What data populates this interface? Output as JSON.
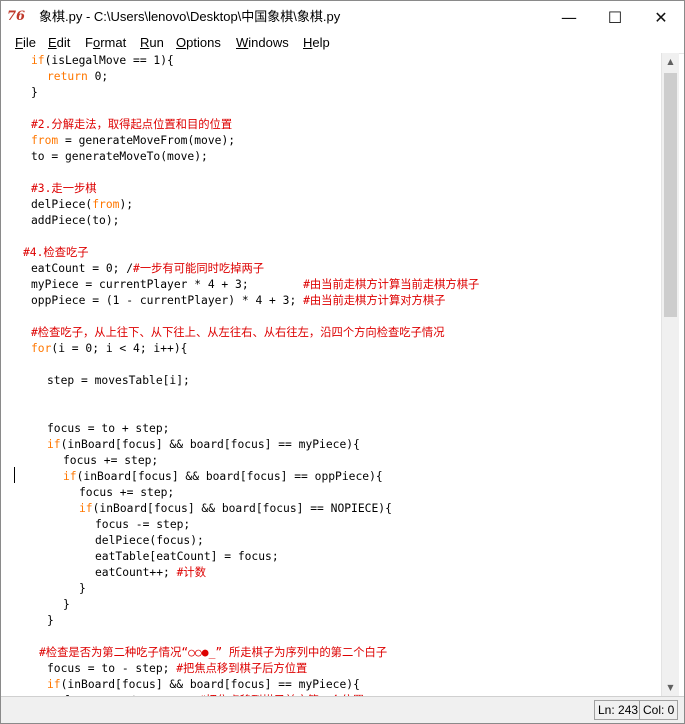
{
  "window": {
    "icon_text": "76",
    "title": "象棋.py - C:\\Users\\lenovo\\Desktop\\中国象棋\\象棋.py",
    "minimize_glyph": "—",
    "maximize_glyph": "☐",
    "close_glyph": "✕"
  },
  "menu": [
    {
      "u": "F",
      "rest": "ile"
    },
    {
      "u": "E",
      "rest": "dit"
    },
    {
      "pre": "F",
      "u": "o",
      "rest": "rmat"
    },
    {
      "u": "R",
      "rest": "un"
    },
    {
      "u": "O",
      "rest": "ptions"
    },
    {
      "u": "W",
      "rest": "indows"
    },
    {
      "u": "H",
      "rest": "elp"
    }
  ],
  "code": [
    {
      "x": 30,
      "parts": [
        {
          "t": "if",
          "c": "kw"
        },
        {
          "t": "(isLegalMove == 1){"
        }
      ]
    },
    {
      "x": 46,
      "parts": [
        {
          "t": "return",
          "c": "kw"
        },
        {
          "t": " 0;"
        }
      ]
    },
    {
      "x": 30,
      "parts": [
        {
          "t": "}"
        }
      ]
    },
    {
      "x": 30,
      "parts": []
    },
    {
      "x": 30,
      "parts": [
        {
          "t": "#2.分解走法，取得起点位置和目的位置",
          "c": "cm"
        }
      ]
    },
    {
      "x": 30,
      "parts": [
        {
          "t": "from",
          "c": "kw"
        },
        {
          "t": " = generateMoveFrom(move);"
        }
      ]
    },
    {
      "x": 30,
      "parts": [
        {
          "t": "to = generateMoveTo(move);"
        }
      ]
    },
    {
      "x": 30,
      "parts": []
    },
    {
      "x": 30,
      "parts": [
        {
          "t": "#3.走一步棋",
          "c": "cm"
        }
      ]
    },
    {
      "x": 30,
      "parts": [
        {
          "t": "delPiece("
        },
        {
          "t": "from",
          "c": "kw"
        },
        {
          "t": ");"
        }
      ]
    },
    {
      "x": 30,
      "parts": [
        {
          "t": "addPiece(to);"
        }
      ]
    },
    {
      "x": 30,
      "parts": []
    },
    {
      "x": 22,
      "parts": [
        {
          "t": "#4.检查吃子",
          "c": "cm"
        }
      ]
    },
    {
      "x": 30,
      "parts": [
        {
          "t": "eatCount = 0; /"
        },
        {
          "t": "#一步有可能同时吃掉两子",
          "c": "cm"
        }
      ]
    },
    {
      "x": 30,
      "parts": [
        {
          "t": "myPiece = currentPlayer * 4 + 3;        "
        },
        {
          "t": "#由当前走棋方计算当前走棋方棋子",
          "c": "cm"
        }
      ]
    },
    {
      "x": 30,
      "parts": [
        {
          "t": "oppPiece = (1 - currentPlayer) * 4 + 3; "
        },
        {
          "t": "#由当前走棋方计算对方棋子",
          "c": "cm"
        }
      ]
    },
    {
      "x": 30,
      "parts": []
    },
    {
      "x": 30,
      "parts": [
        {
          "t": "#检查吃子，从上往下、从下往上、从左往右、从右往左，沿四个方向检查吃子情况",
          "c": "cm"
        }
      ]
    },
    {
      "x": 30,
      "parts": [
        {
          "t": "for",
          "c": "kw"
        },
        {
          "t": "(i = 0; i < 4; i++){"
        }
      ]
    },
    {
      "x": 30,
      "parts": []
    },
    {
      "x": 46,
      "parts": [
        {
          "t": "step = movesTable[i];"
        }
      ]
    },
    {
      "x": 30,
      "parts": []
    },
    {
      "x": 30,
      "parts": []
    },
    {
      "x": 46,
      "parts": [
        {
          "t": "focus = to + step;"
        }
      ]
    },
    {
      "x": 46,
      "parts": [
        {
          "t": "if",
          "c": "kw"
        },
        {
          "t": "(inBoard[focus] && board[focus] == myPiece){"
        }
      ]
    },
    {
      "x": 62,
      "parts": [
        {
          "t": "focus += step;"
        }
      ]
    },
    {
      "x": 62,
      "parts": [
        {
          "t": "if",
          "c": "kw"
        },
        {
          "t": "(inBoard[focus] && board[focus] == oppPiece){"
        }
      ]
    },
    {
      "x": 78,
      "parts": [
        {
          "t": "focus += step;"
        }
      ]
    },
    {
      "x": 78,
      "parts": [
        {
          "t": "if",
          "c": "kw"
        },
        {
          "t": "(inBoard[focus] && board[focus] == NOPIECE){"
        }
      ]
    },
    {
      "x": 94,
      "parts": [
        {
          "t": "focus -= step;"
        }
      ]
    },
    {
      "x": 94,
      "parts": [
        {
          "t": "delPiece(focus);"
        }
      ]
    },
    {
      "x": 94,
      "parts": [
        {
          "t": "eatTable[eatCount] = focus;"
        }
      ]
    },
    {
      "x": 94,
      "parts": [
        {
          "t": "eatCount++; "
        },
        {
          "t": "#计数",
          "c": "cm"
        }
      ]
    },
    {
      "x": 78,
      "parts": [
        {
          "t": "}"
        }
      ]
    },
    {
      "x": 62,
      "parts": [
        {
          "t": "}"
        }
      ]
    },
    {
      "x": 46,
      "parts": [
        {
          "t": "}"
        }
      ]
    },
    {
      "x": 30,
      "parts": []
    },
    {
      "x": 38,
      "parts": [
        {
          "t": "#检查是否为第二种吃子情况“○○●_” 所走棋子为序列中的第二个白子",
          "c": "cm"
        }
      ]
    },
    {
      "x": 46,
      "parts": [
        {
          "t": "focus = to - step; "
        },
        {
          "t": "#把焦点移到棋子后方位置",
          "c": "cm"
        }
      ]
    },
    {
      "x": 46,
      "parts": [
        {
          "t": "if",
          "c": "kw"
        },
        {
          "t": "(inBoard[focus] && board[focus] == myPiece){"
        }
      ]
    },
    {
      "x": 62,
      "parts": [
        {
          "t": "focus -= step;      "
        },
        {
          "t": "#把焦点移到棋子前方第一个位置",
          "c": "cm"
        }
      ]
    }
  ],
  "scroll": {
    "up_glyph": "▲",
    "down_glyph": "▼"
  },
  "status": {
    "line": "Ln: 243",
    "col": "Col: 0"
  }
}
